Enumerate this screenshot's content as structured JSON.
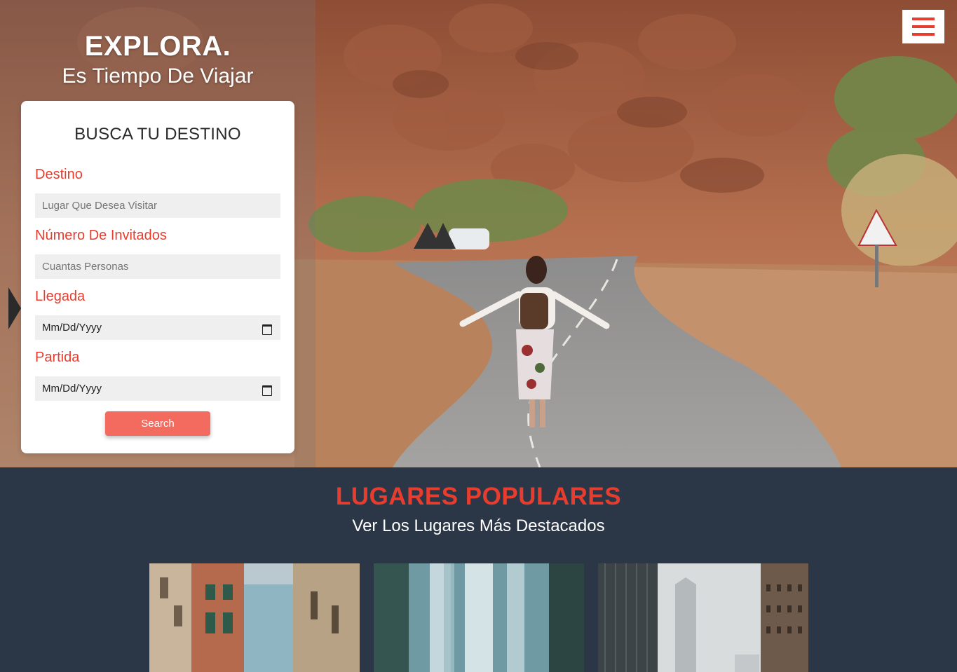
{
  "hero": {
    "title": "EXPLORA.",
    "subtitle": "Es Tiempo De Viajar",
    "menu_icon": "hamburger-icon",
    "arrow_icon": "chevron-right-icon"
  },
  "search_form": {
    "title": "BUSCA TU DESTINO",
    "fields": [
      {
        "label": "Destino",
        "placeholder": "Lugar Que Desea Visitar",
        "type": "text"
      },
      {
        "label": "Número De Invitados",
        "placeholder": "Cuantas Personas",
        "type": "number"
      },
      {
        "label": "Llegada",
        "value": "Mm/Dd/Yyyy",
        "type": "date",
        "icon": "calendar-icon"
      },
      {
        "label": "Partida",
        "value": "Mm/Dd/Yyyy",
        "type": "date",
        "icon": "calendar-icon"
      }
    ],
    "submit_label": "Search"
  },
  "popular": {
    "title": "LUGARES POPULARES",
    "subtitle": "Ver Los Lugares Más Destacados",
    "cards": [
      {
        "image": "venice-canal-street"
      },
      {
        "image": "waterfall"
      },
      {
        "image": "city-skyscrapers"
      }
    ]
  },
  "colors": {
    "accent": "#e63d2f",
    "button": "#f26b5e",
    "section_bg": "#2b3747",
    "input_bg": "#efefef"
  }
}
